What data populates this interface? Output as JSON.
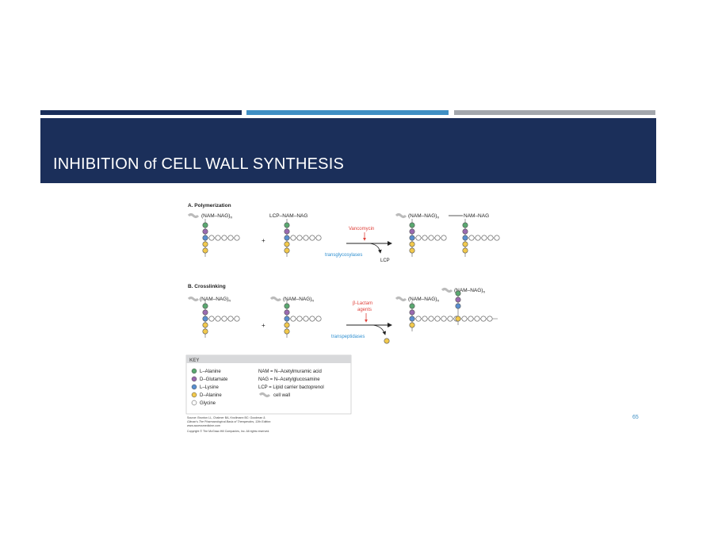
{
  "slide": {
    "title_main": "INHIBITION",
    "title_of": "of",
    "title_rest": "CELL WALL SYNTHESIS",
    "page_number": "65"
  },
  "colors": {
    "navy": "#1b2f5a",
    "blue": "#3f8fc4",
    "gray": "#a3a7ad",
    "l_alanine": "#5aa870",
    "d_glutamate": "#9a6ab0",
    "l_lysine": "#5a8fd0",
    "d_alanine": "#f2c94c",
    "glycine": "#ffffff",
    "inhibitor_red": "#e0413a",
    "enzyme_blue": "#2f8fd0"
  },
  "figure": {
    "panel_a": {
      "heading": "A. Polymerization",
      "chain1": "(NAM–NAG)",
      "chain1_sub": "n",
      "chain2": "LCP–NAM–NAG",
      "plus": "+",
      "inhibitor": "Vancomycin",
      "enzyme": "transglycosylases",
      "byproduct": "LCP",
      "product": "(NAM–NAG)",
      "product_sub": "n",
      "product_tail": "NAM–NAG"
    },
    "panel_b": {
      "heading": "B. Crosslinking",
      "chain1": "(NAM–NAG)",
      "chain1_sub": "n",
      "chain2": "(NAM–NAG)",
      "chain2_sub": "n",
      "plus": "+",
      "inhibitor_line1": "β-Lactam",
      "inhibitor_line2": "agents",
      "enzyme": "transpeptidases",
      "product_left": "(NAM–NAG)",
      "product_left_sub": "n",
      "product_right": "(NAM–NAG)",
      "product_right_sub": "n"
    },
    "key": {
      "heading": "KEY",
      "legend": [
        "L–Alanine",
        "D–Glutamate",
        "L–Lysine",
        "D–Alanine",
        "Glycine"
      ],
      "definitions": [
        "NAM = N–Acetylmuramic acid",
        "NAG = N–Acetylglucosamine",
        "LCP = Lipid carrier bactoprenol",
        "cell wall"
      ]
    },
    "source": [
      "Source: Brunton LL, Chabner BA, Knollmann BC: Goodman &",
      "Gilman's The Pharmacological Basis of Therapeutics, 12th Edition:",
      "www.accessmedicine.com",
      "Copyright © The McGraw-Hill Companies, Inc. All rights reserved."
    ]
  }
}
